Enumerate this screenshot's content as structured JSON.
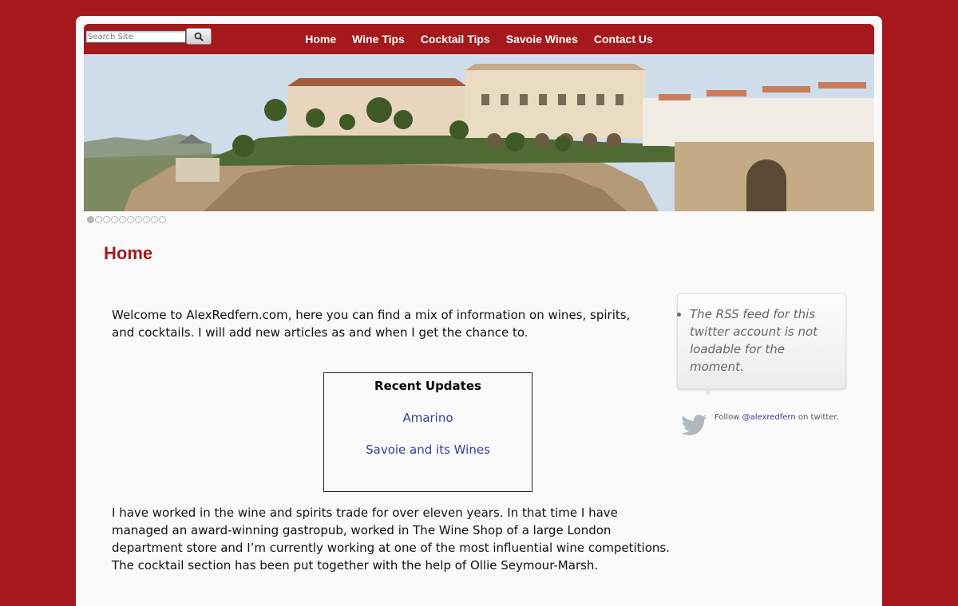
{
  "search": {
    "placeholder": "Search Site"
  },
  "nav": {
    "items": [
      "Home",
      "Wine Tips",
      "Cocktail Tips",
      "Savoie Wines",
      "Contact Us"
    ]
  },
  "slider": {
    "dot_count": 10,
    "active_index": 0
  },
  "page": {
    "title": "Home"
  },
  "content": {
    "intro": "Welcome to AlexRedfern.com, here you can find a mix of information on wines, spirits, and cocktails. I will add new articles as and when I get the chance to.",
    "recent_updates": {
      "heading": "Recent Updates",
      "links": [
        "Amarino",
        "Savoie and its Wines"
      ]
    },
    "about": "I have worked in the wine and spirits trade for over eleven years. In that time I have managed an award-winning gastropub, worked in The Wine Shop of a large London department store and I’m currently working at one of the most influential wine competitions. The cocktail section has been put together with the help of Ollie Seymour-Marsh."
  },
  "sidebar": {
    "tweet_message": "The RSS feed for this twitter account is not loadable for the moment.",
    "follow_prefix": "Follow",
    "follow_handle": "@alexredfern",
    "follow_suffix": "on twitter."
  },
  "colors": {
    "brand": "#a5181b",
    "link": "#3b3b99"
  }
}
